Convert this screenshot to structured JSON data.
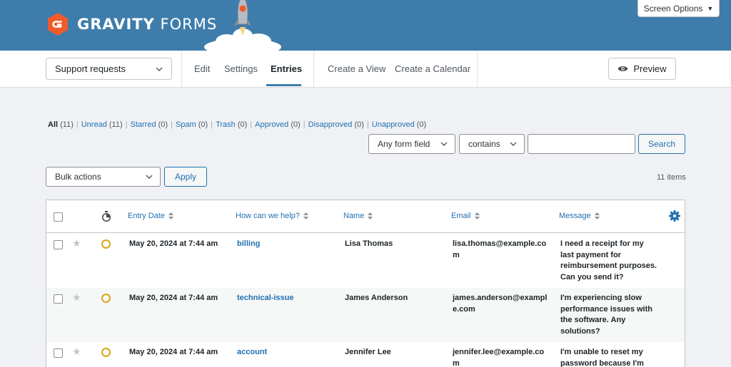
{
  "brand": {
    "name_bold": "GRAVITY",
    "name_light": " FORMS"
  },
  "screen_options": {
    "label": "Screen Options"
  },
  "toolbar": {
    "form_select": "Support requests",
    "nav": {
      "edit": "Edit",
      "settings": "Settings",
      "entries": "Entries",
      "create_view": "Create a View",
      "create_calendar": "Create a Calendar"
    },
    "active_tab": "Entries",
    "preview": "Preview"
  },
  "filters": [
    {
      "label": "All",
      "count": "(11)",
      "current": true
    },
    {
      "label": "Unread",
      "count": "(11)"
    },
    {
      "label": "Starred",
      "count": "(0)"
    },
    {
      "label": "Spam",
      "count": "(0)"
    },
    {
      "label": "Trash",
      "count": "(0)"
    },
    {
      "label": "Approved",
      "count": "(0)"
    },
    {
      "label": "Disapproved",
      "count": "(0)"
    },
    {
      "label": "Unapproved",
      "count": "(0)"
    }
  ],
  "search": {
    "field": "Any form field",
    "operator": "contains",
    "value": "",
    "button": "Search"
  },
  "bulk": {
    "label": "Bulk actions",
    "apply": "Apply"
  },
  "items_count": "11 items",
  "table": {
    "columns": {
      "entry_date": "Entry Date",
      "how": "How can we help?",
      "name": "Name",
      "email": "Email",
      "message": "Message"
    },
    "rows": [
      {
        "date": "May 20, 2024 at 7:44 am",
        "topic": "billing",
        "name": "Lisa Thomas",
        "email_1": "lisa.thomas@example.co",
        "email_2": "m",
        "msg_1": "I need a receipt for my",
        "msg_2": "last payment for",
        "msg_3": "reimbursement purposes.",
        "msg_4": "Can you send it?"
      },
      {
        "date": "May 20, 2024 at 7:44 am",
        "topic": "technical-issue",
        "name": "James Anderson",
        "email_1": "james.anderson@exampl",
        "email_2": "e.com",
        "msg_1": "I'm experiencing slow",
        "msg_2": "performance issues with",
        "msg_3": "the software. Any",
        "msg_4": "solutions?"
      },
      {
        "date": "May 20, 2024 at 7:44 am",
        "topic": "account",
        "name": "Jennifer Lee",
        "email_1": "jennifer.lee@example.co",
        "email_2": "m",
        "msg_1": "I'm unable to reset my",
        "msg_2": "password because I'm",
        "msg_3": "",
        "msg_4": ""
      }
    ]
  },
  "colors": {
    "brand_blue": "#3e7dab",
    "brand_orange": "#f15a2b",
    "link": "#2271b1",
    "unread_dot": "#dba617"
  },
  "icons": [
    "gravity-forms-logo-icon",
    "rocket-icon",
    "chevron-down-icon",
    "eye-icon",
    "sort-icon",
    "stopwatch-icon",
    "star-icon",
    "gear-icon"
  ]
}
